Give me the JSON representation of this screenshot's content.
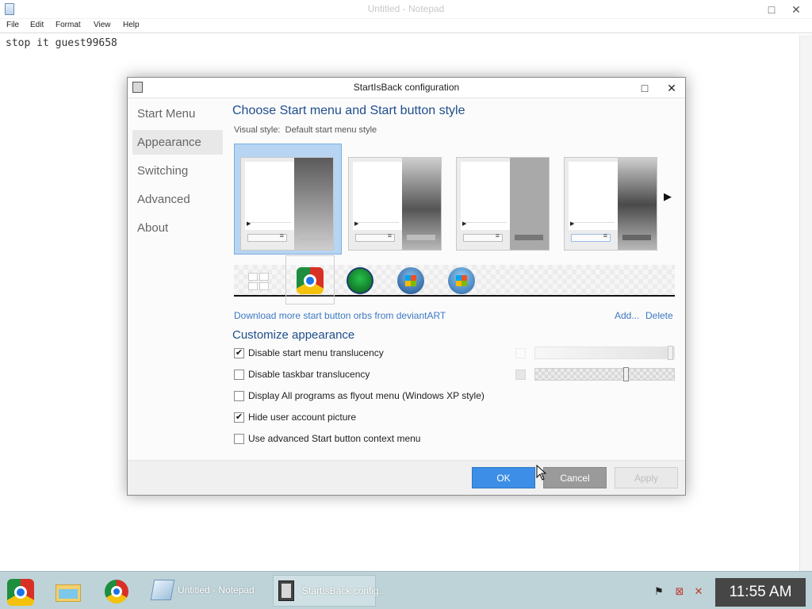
{
  "notepad": {
    "title": "Untitled - Notepad",
    "menu": [
      "File",
      "Edit",
      "Format",
      "View",
      "Help"
    ],
    "content": "stop it guest99658"
  },
  "dialog": {
    "title": "StartIsBack configuration",
    "nav": [
      "Start Menu",
      "Appearance",
      "Switching",
      "Advanced",
      "About"
    ],
    "active_nav": "Appearance",
    "heading_style": "Choose Start menu and Start button style",
    "visual_style_label": "Visual style:",
    "visual_style_value": "Default start menu style",
    "download_link": "Download more start button orbs from deviantART",
    "add_link": "Add...",
    "delete_link": "Delete",
    "heading_customize": "Customize appearance",
    "options": [
      {
        "label": "Disable start menu translucency",
        "checked": true
      },
      {
        "label": "Disable taskbar translucency",
        "checked": false
      },
      {
        "label": "Display All programs as flyout menu (Windows XP style)",
        "checked": false
      },
      {
        "label": "Hide user account picture",
        "checked": true
      },
      {
        "label": "Use advanced Start button context menu",
        "checked": false
      }
    ],
    "buttons": {
      "ok": "OK",
      "cancel": "Cancel",
      "apply": "Apply"
    },
    "glyphs": {
      "checkmark": "✔",
      "next": "▶",
      "maximize": "□",
      "close": "✕"
    },
    "colors": {
      "accent": "#3c8ee6",
      "heading": "#1e4e8c",
      "link": "#3d79c4"
    }
  },
  "taskbar": {
    "tasks": [
      "Untitled - Notepad",
      "StartIsBack config..."
    ],
    "clock": "11:55 AM"
  }
}
